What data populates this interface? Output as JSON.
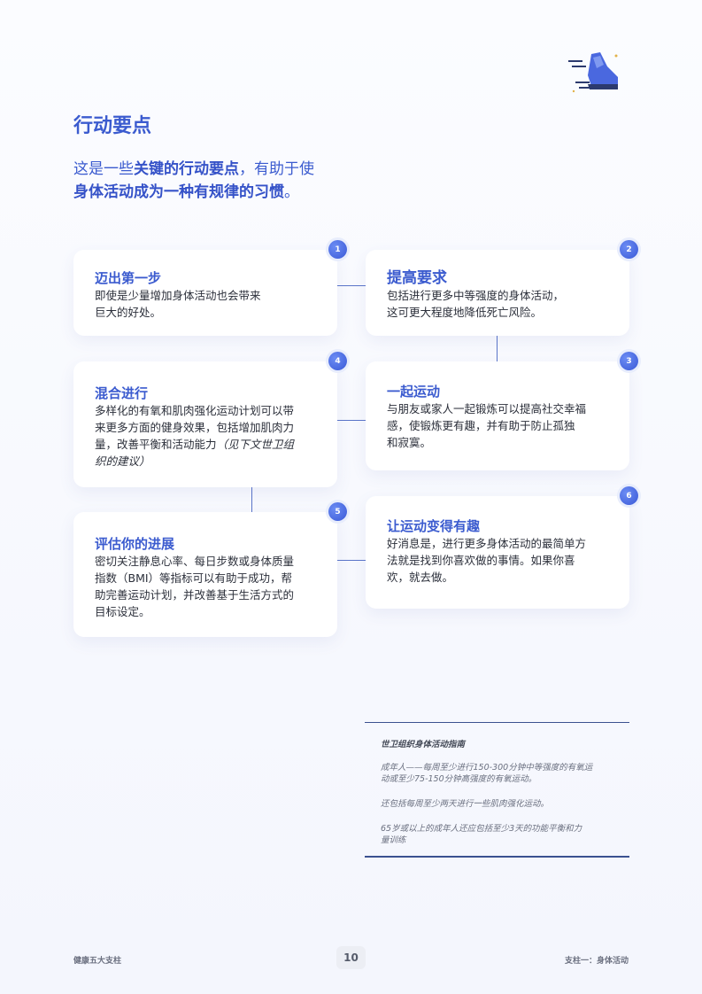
{
  "title": "行动要点",
  "intro": {
    "part1": "这是一些",
    "bold1": "关键的行动要点",
    "part2": "，有助于使",
    "bold2": "身体活动成为一种有规律的习惯",
    "part3": "。"
  },
  "cards": [
    {
      "number": "1",
      "title": "迈出第一步",
      "lines": [
        "即使是少量增加身体活动也会带来",
        "巨大的好处。"
      ]
    },
    {
      "number": "2",
      "title": "提高要求",
      "lines": [
        "包括进行更多中等强度的身体活动，",
        "这可更大程度地降低死亡风险。"
      ]
    },
    {
      "number": "3",
      "title": "一起运动",
      "lines": [
        "与朋友或家人一起锻炼可以提高社交幸福",
        "感，使锻炼更有趣，并有助于防止孤独",
        "和寂寞。"
      ]
    },
    {
      "number": "4",
      "title": "混合进行",
      "lines": [
        "多样化的有氧和肌肉强化运动计划可以带",
        "来更多方面的健身效果，包括增加肌肉力",
        "量，改善平衡和活动能力"
      ],
      "italic_a": "（见下文世卫组",
      "italic_b": "织的建议）"
    },
    {
      "number": "5",
      "title": "评估你的进展",
      "lines": [
        "密切关注静息心率、每日步数或身体质量",
        "指数（BMI）等指标可以有助于成功，帮",
        "助完善运动计划，并改善基于生活方式的",
        "目标设定。"
      ]
    },
    {
      "number": "6",
      "title": "让运动变得有趣",
      "lines": [
        "好消息是，进行更多身体活动的最简单方",
        "法就是找到你喜欢做的事情。如果你喜",
        "欢，就去做。"
      ]
    }
  ],
  "who_box": {
    "title": "世卫组织身体活动指南",
    "line1a": "成年人——每周至少进行150-300分钟中等强度的有氧运",
    "line1b": "动或至少75-150分钟高强度的有氧运动。",
    "line2": "还包括每周至少两天进行一些肌肉强化运动。",
    "line3a": "65岁或以上的成年人还应包括至少3天的功能平衡和力",
    "line3b": "量训练"
  },
  "footer": {
    "left": "健康五大支柱",
    "page": "10",
    "right": "支柱一：身体活动"
  },
  "colors": {
    "accent": "#3b5bcf",
    "badge": "#4a68df",
    "line": "#5b76c9"
  },
  "icons": {
    "logo": "running-shoe-icon"
  }
}
